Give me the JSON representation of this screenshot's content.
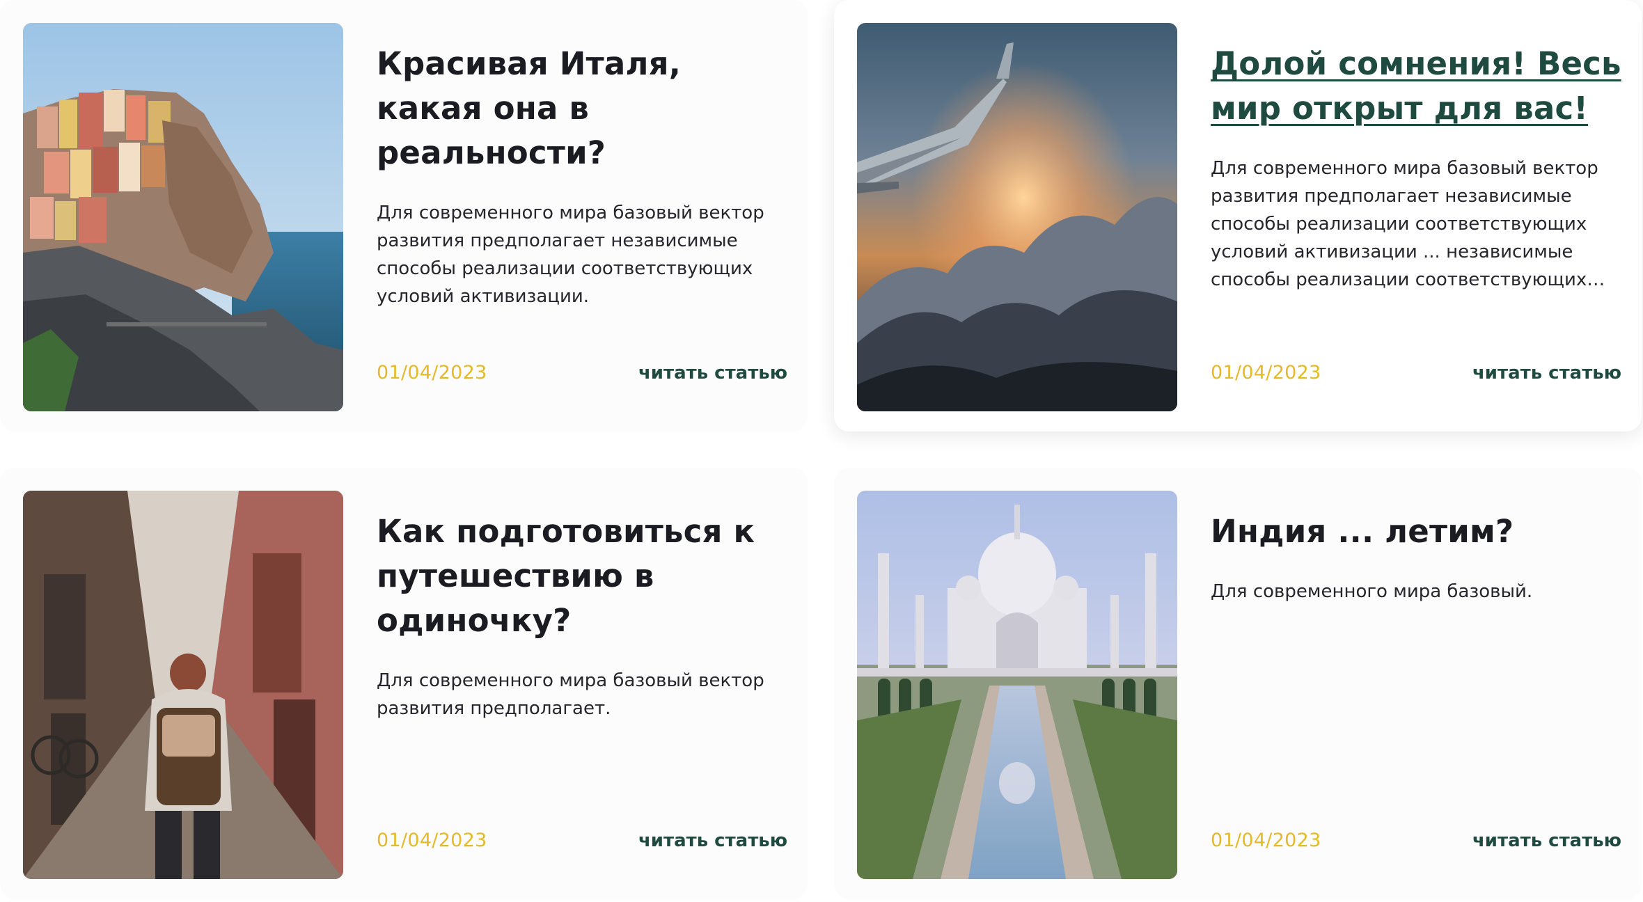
{
  "articles": [
    {
      "title": "Красивая Италя, какая она в реальности?",
      "excerpt": "Для современного мира базовый вектор развития предполагает независимые способы реализации соответствующих условий активизации.",
      "date": "01/04/2023",
      "read_label": "читать статью",
      "image": "italy-coast-photo"
    },
    {
      "title": "Долой сомнения! Весь мир открыт для вас!",
      "excerpt": "Для современного мира базовый вектор развития предполагает независимые способы реализации соответствующих условий активизации ... независимые способы реализации соответствующих условий активизации.",
      "date": "01/04/2023",
      "read_label": "читать статью",
      "image": "airplane-wing-clouds-photo"
    },
    {
      "title": "Как подготовиться к путешествию в одиночку?",
      "excerpt": "Для современного мира базовый вектор развития предполагает.",
      "date": "01/04/2023",
      "read_label": "читать статью",
      "image": "solo-traveler-street-photo"
    },
    {
      "title": "Индия ... летим?",
      "excerpt": "Для современного мира базовый.",
      "date": "01/04/2023",
      "read_label": "читать статью",
      "image": "taj-mahal-photo"
    }
  ],
  "colors": {
    "title": "#1b1c22",
    "title_hover": "#1e4a3f",
    "date": "#e5b92a",
    "link": "#1e4a3f",
    "text": "#26262c"
  }
}
